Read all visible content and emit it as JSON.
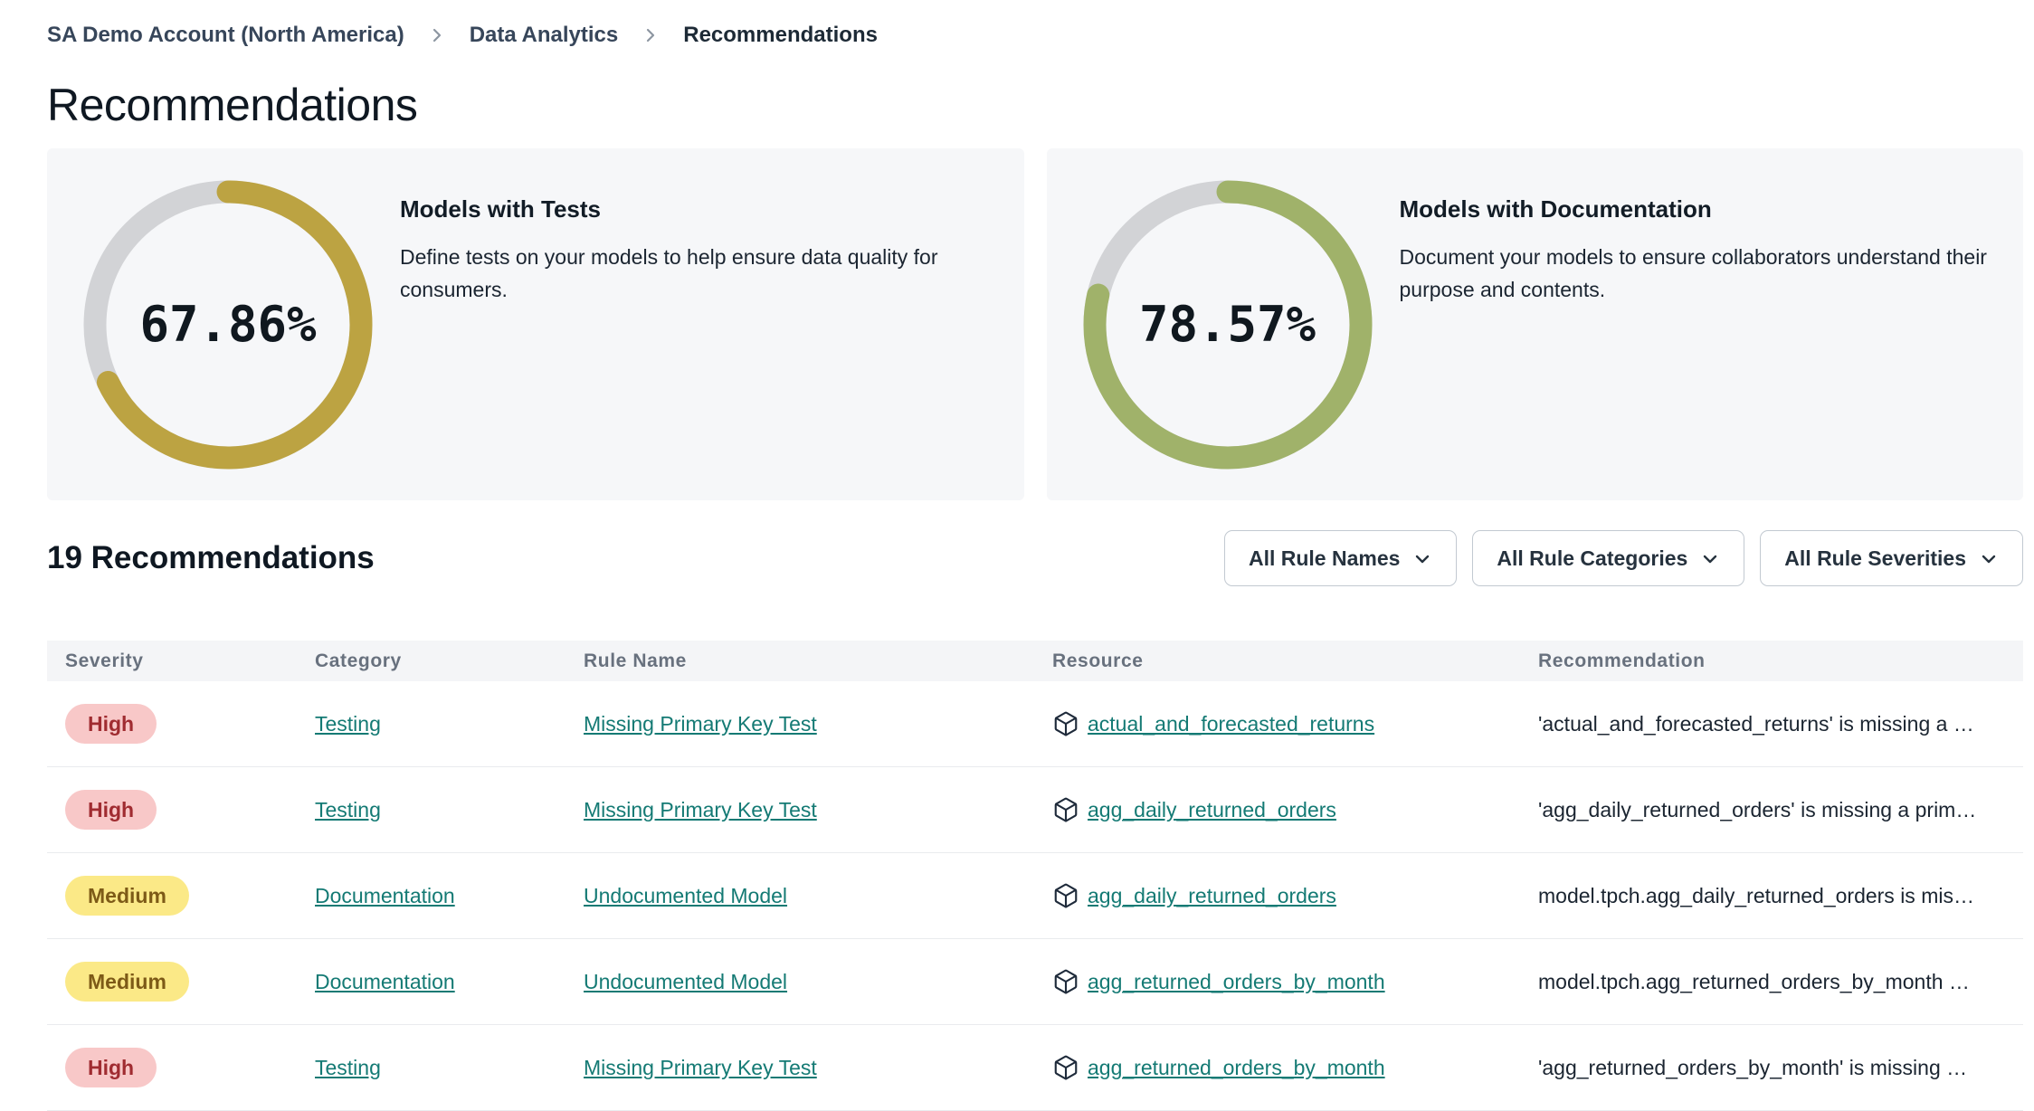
{
  "colors": {
    "link": "#147a74",
    "high_bg": "#f8c8c8",
    "high_text": "#a02c31",
    "medium_bg": "#fbe987",
    "medium_text": "#7d5a17",
    "tests_donut": "#bca342",
    "docs_donut": "#a0b26a",
    "donut_track": "#d2d3d6"
  },
  "breadcrumb": {
    "items": [
      "SA Demo Account (North America)",
      "Data Analytics",
      "Recommendations"
    ]
  },
  "page_title": "Recommendations",
  "cards": [
    {
      "title": "Models with Tests",
      "description": "Define tests on your models to help ensure data quality for consumers.",
      "percent": 67.86,
      "percent_label": "67.86%",
      "color": "#bca342",
      "track_color": "#d2d3d6"
    },
    {
      "title": "Models with Documentation",
      "description": "Document your models to ensure collaborators understand their purpose and contents.",
      "percent": 78.57,
      "percent_label": "78.57%",
      "color": "#a0b26a",
      "track_color": "#d2d3d6"
    }
  ],
  "section": {
    "heading": "19 Recommendations",
    "filters": [
      {
        "label": "All Rule Names"
      },
      {
        "label": "All Rule Categories"
      },
      {
        "label": "All Rule Severities"
      }
    ]
  },
  "table": {
    "columns": [
      "Severity",
      "Category",
      "Rule Name",
      "Resource",
      "Recommendation"
    ],
    "rows": [
      {
        "severity": "High",
        "category": "Testing",
        "rule_name": "Missing Primary Key Test",
        "resource": "actual_and_forecasted_returns",
        "recommendation": "'actual_and_forecasted_returns' is missing a …"
      },
      {
        "severity": "High",
        "category": "Testing",
        "rule_name": "Missing Primary Key Test",
        "resource": "agg_daily_returned_orders",
        "recommendation": "'agg_daily_returned_orders' is missing a prim…"
      },
      {
        "severity": "Medium",
        "category": "Documentation",
        "rule_name": "Undocumented Model",
        "resource": "agg_daily_returned_orders",
        "recommendation": "model.tpch.agg_daily_returned_orders is mis…"
      },
      {
        "severity": "Medium",
        "category": "Documentation",
        "rule_name": "Undocumented Model",
        "resource": "agg_returned_orders_by_month",
        "recommendation": "model.tpch.agg_returned_orders_by_month …"
      },
      {
        "severity": "High",
        "category": "Testing",
        "rule_name": "Missing Primary Key Test",
        "resource": "agg_returned_orders_by_month",
        "recommendation": "'agg_returned_orders_by_month' is missing …"
      }
    ]
  }
}
